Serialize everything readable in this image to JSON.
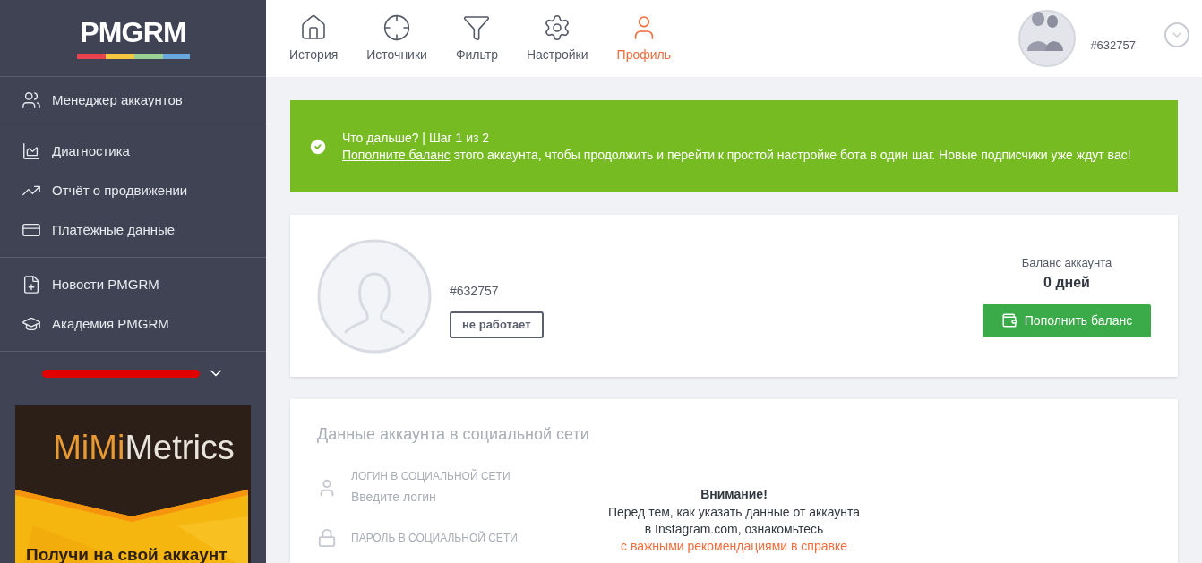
{
  "logo": {
    "text": "PMGRM"
  },
  "sidebar": {
    "groups": [
      [
        {
          "label": "Менеджер аккаунтов"
        }
      ],
      [
        {
          "label": "Диагностика"
        },
        {
          "label": "Отчёт о продвижении"
        },
        {
          "label": "Платёжные данные"
        }
      ],
      [
        {
          "label": "Новости PMGRM"
        },
        {
          "label": "Академия PMGRM"
        }
      ]
    ],
    "account_switcher": {
      "redacted": true
    },
    "ad": {
      "brand_first": "MiMi",
      "brand_second": "Metrics",
      "headline": "Получи на свой аккаунт"
    }
  },
  "nav": {
    "tabs": [
      {
        "label": "История",
        "selected": false
      },
      {
        "label": "Источники",
        "selected": false
      },
      {
        "label": "Фильтр",
        "selected": false
      },
      {
        "label": "Настройки",
        "selected": false
      },
      {
        "label": "Профиль",
        "selected": true
      }
    ]
  },
  "user_menu": {
    "id": "#632757"
  },
  "alert": {
    "title": "Что дальше? | Шаг 1 из 2",
    "link": "Пополните баланс",
    "text": "этого аккаунта, чтобы продолжить и перейти к простой настройке бота в один шаг. Новые подписчики уже ждут вас!"
  },
  "profile": {
    "id": "#632757",
    "status": "не работает",
    "balance_label": "Баланс аккаунта",
    "balance_value": "0 дней",
    "topup_button": "Пополнить баланс"
  },
  "social": {
    "title": "Данные аккаунта в социальной сети",
    "fields": [
      {
        "label": "ЛОГИН В СОЦИАЛЬНОЙ СЕТИ",
        "placeholder": "Введите логин"
      },
      {
        "label": "ПАРОЛЬ В СОЦИАЛЬНОЙ СЕТИ"
      }
    ],
    "notice": {
      "title": "Внимание!",
      "text": "Перед тем, как указать данные от аккаунта в Instagram.com, ознакомьтесь",
      "link": "с важными рекомендациями в справке"
    }
  }
}
